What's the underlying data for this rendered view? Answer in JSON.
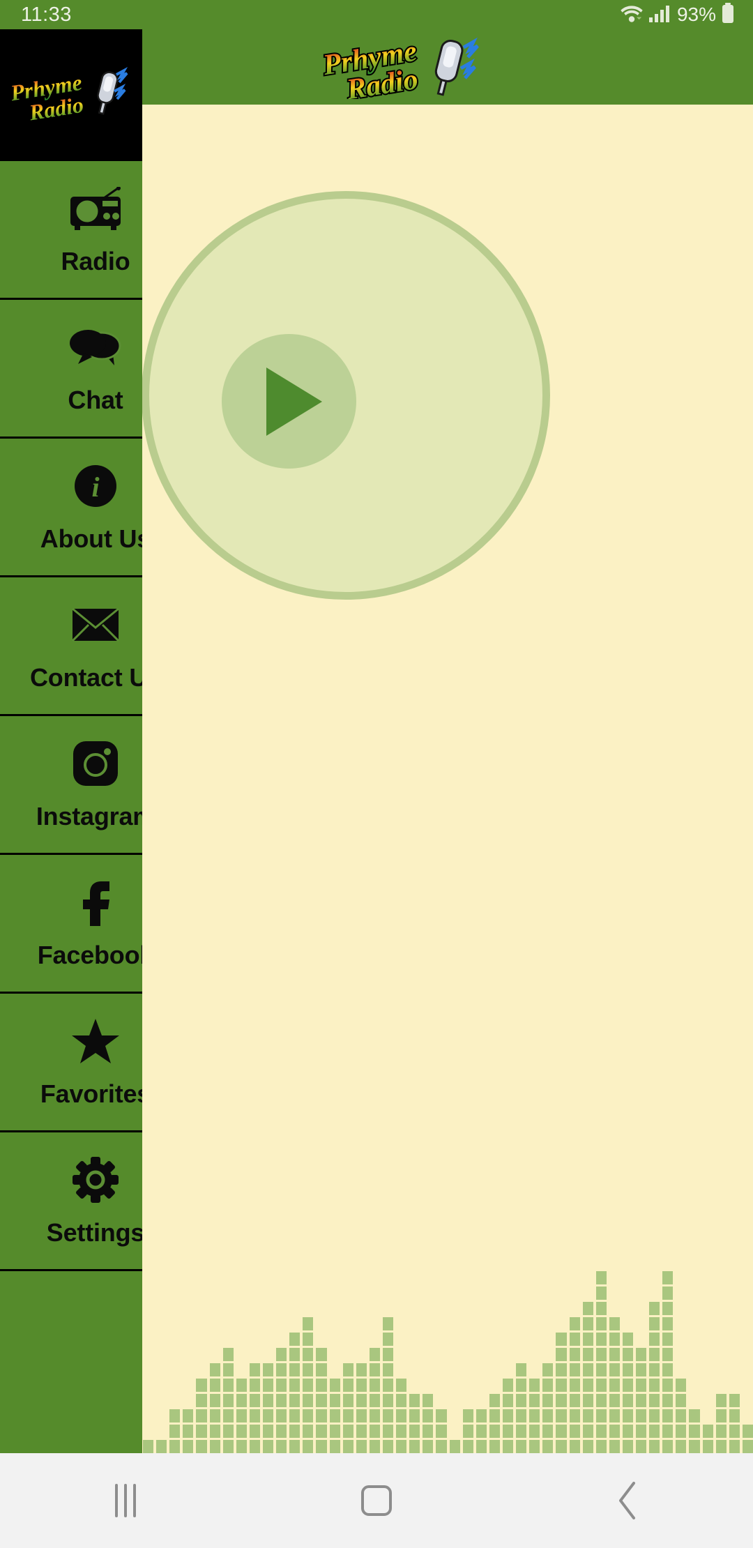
{
  "status_bar": {
    "time": "11:33",
    "battery_percent": "93%",
    "wifi_icon": "wifi-icon",
    "signal_icon": "cellular-signal-icon",
    "battery_icon": "battery-icon",
    "background_color": "#558b2b",
    "text_color": "#eef2e6"
  },
  "header": {
    "logo_alt": "Prhyme Radio",
    "logo_line1": "Prhyme",
    "logo_line2": "Radio",
    "background_color": "#558b2b"
  },
  "sidebar": {
    "background_color": "#558b2b",
    "logo_tile": {
      "background_color": "#000000",
      "logo_line1": "Prhyme",
      "logo_line2": "Radio"
    },
    "items": [
      {
        "label": "Radio",
        "icon": "radio-icon"
      },
      {
        "label": "Chat",
        "icon": "chat-bubbles-icon"
      },
      {
        "label": "About Us",
        "icon": "info-circle-icon"
      },
      {
        "label": "Contact Us",
        "icon": "envelope-icon"
      },
      {
        "label": "Instagram",
        "icon": "instagram-icon"
      },
      {
        "label": "Facebook",
        "icon": "facebook-icon"
      },
      {
        "label": "Favorites",
        "icon": "star-icon"
      },
      {
        "label": "Settings",
        "icon": "gear-icon"
      }
    ]
  },
  "player": {
    "background_color": "#fbf1c4",
    "disc_ring_color": "#b9cc8e",
    "disc_face_color": "#e3e8b6",
    "play_button_color": "#bcd196",
    "play_triangle_color": "#4e8b2e",
    "play_button_label": "Play",
    "state": "paused"
  },
  "equalizer": {
    "bar_color": "#a9c67f",
    "levels": [
      1,
      1,
      3,
      3,
      5,
      6,
      7,
      5,
      6,
      6,
      7,
      8,
      9,
      7,
      5,
      6,
      6,
      7,
      9,
      5,
      4,
      4,
      3,
      1,
      3,
      3,
      4,
      5,
      6,
      5,
      6,
      8,
      9,
      10,
      12,
      9,
      8,
      7,
      10,
      12,
      5,
      3,
      2,
      4,
      4,
      2
    ]
  },
  "nav_bar": {
    "background_color": "#f2f2f2",
    "buttons": [
      {
        "name": "recents",
        "icon": "recents-icon"
      },
      {
        "name": "home",
        "icon": "home-icon"
      },
      {
        "name": "back",
        "icon": "back-chevron-icon"
      }
    ]
  }
}
